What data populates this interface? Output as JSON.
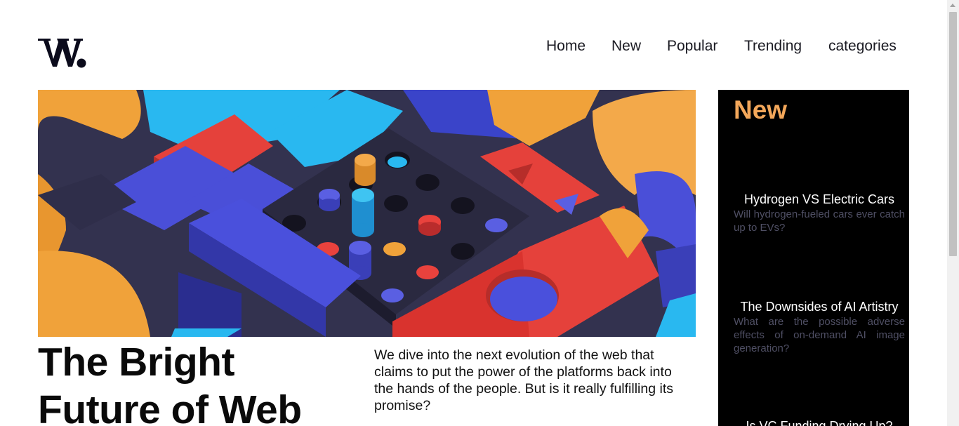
{
  "brand": {
    "logo_text": "W."
  },
  "nav": {
    "items": [
      {
        "label": "Home"
      },
      {
        "label": "New"
      },
      {
        "label": "Popular"
      },
      {
        "label": "Trending"
      },
      {
        "label": "categories"
      }
    ]
  },
  "main": {
    "headline": "The Bright Future of Web",
    "deck": "We dive into the next evolution of the web that claims to put the power of the platforms back into the hands of the people. But is it really fulfilling its promise?"
  },
  "sidebar": {
    "title": "New",
    "articles": [
      {
        "title": "Hydrogen VS Electric Cars",
        "desc": "Will hydrogen-fueled cars ever catch up to EVs?"
      },
      {
        "title": "The Downsides of AI Artistry",
        "desc": "What are the possible adverse effects of on-demand AI image generation?"
      },
      {
        "title": "Is VC Funding Drying Up?",
        "desc": ""
      }
    ]
  },
  "colors": {
    "accent": "#f3a75a",
    "sidebar_bg": "#000000",
    "muted_text": "#4f4f64",
    "text": "#0b0b16"
  },
  "icons": {
    "logo": "w-logo-mark",
    "scroll_up": "arrow-up-icon"
  }
}
